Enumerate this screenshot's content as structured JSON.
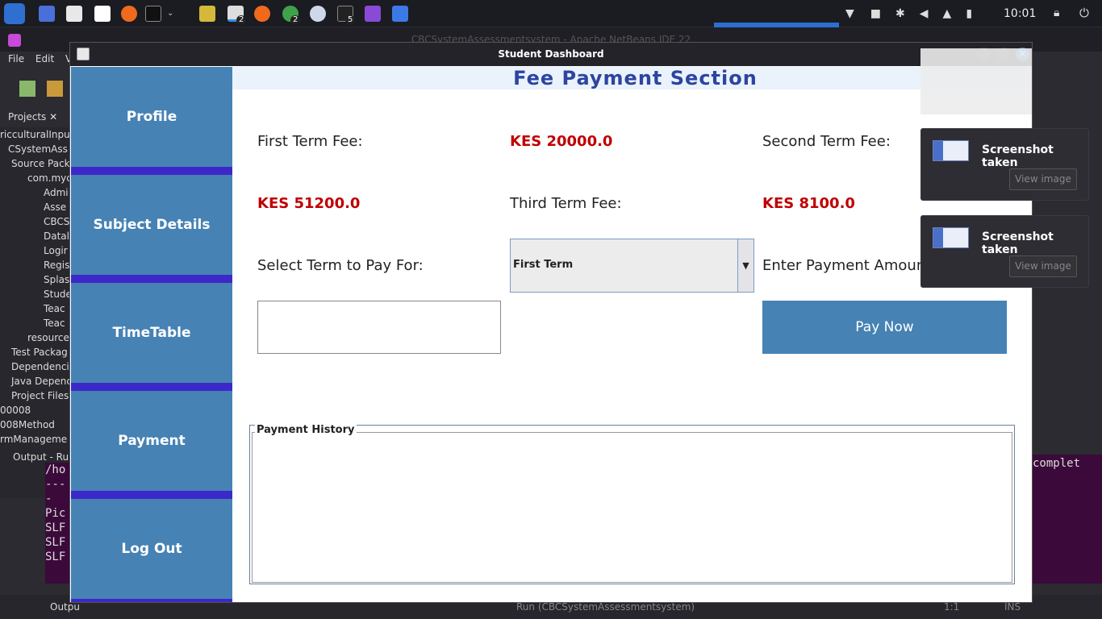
{
  "taskbar": {
    "clock": "10:01",
    "badges": [
      "2",
      "2",
      "5"
    ]
  },
  "background": {
    "window_title": "CBCSystemAssessmentsystem - Apache NetBeans IDE 22",
    "menu": [
      "File",
      "Edit",
      "V"
    ],
    "projects_tab": "Projects",
    "tree_items": [
      "ricculturalInput",
      "CSystemAss",
      "Source Pack",
      "com.myc",
      "Admi",
      "Asse",
      "CBCS",
      "Datal",
      "Logir",
      "Regis",
      "Splas",
      "Stude",
      "Teac",
      "Teac",
      "resource",
      "Test Packag",
      "Dependenci",
      "Java Depenc",
      "Project Files",
      "00008",
      "008Method",
      "rmManageme"
    ],
    "output_tab": "Output - Ru",
    "output_lines": [
      "/ho",
      "----",
      "Pic",
      "SLF",
      "SLF",
      "SLF"
    ],
    "output_right": "complet",
    "status_text": "Run (CBCSystemAssessmentsystem)",
    "status_pos": "1:1",
    "status_mode": "INS",
    "output_bottom_tab": "Outpu"
  },
  "dialog": {
    "title": "Student Dashboard",
    "sidebar": [
      "Profile",
      "Subject Details",
      "TimeTable",
      "Payment",
      "Log Out"
    ],
    "header": "Fee Payment Section",
    "first_term_label": "First Term Fee:",
    "first_term_value": "KES 20000.0",
    "second_term_label": "Second Term Fee:",
    "second_term_value": "KES 51200.0",
    "third_term_label": "Third Term Fee:",
    "third_term_value": "KES 8100.0",
    "select_label": "Select Term to Pay For:",
    "selected_term": "First Term",
    "amount_label": "Enter Payment Amount:",
    "amount_value": "",
    "pay_button": "Pay Now",
    "history_title": "Payment History"
  },
  "notifications": [
    {
      "title": "Screenshot taken",
      "action": "View image"
    },
    {
      "title": "Screenshot taken",
      "action": "View image"
    }
  ],
  "colors": {
    "sidebar_button": "#4682b4",
    "sidebar_separator": "#3c28c8",
    "header_text": "#2e44a0",
    "fee_value": "#c00000"
  }
}
